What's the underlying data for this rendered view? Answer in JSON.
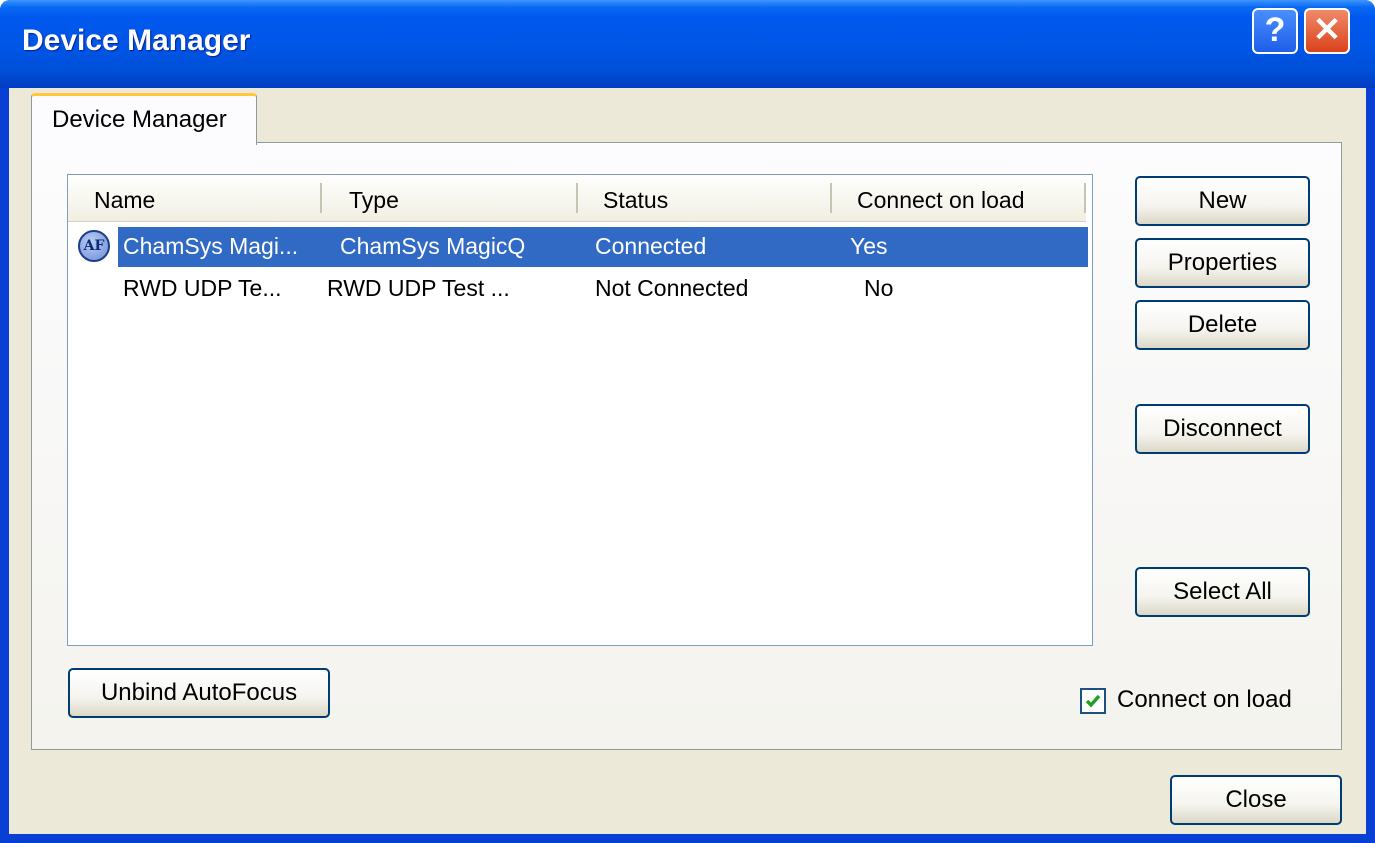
{
  "window": {
    "title": "Device Manager"
  },
  "tab": {
    "label": "Device Manager"
  },
  "table": {
    "columns": [
      "Name",
      "Type",
      "Status",
      "Connect on load"
    ],
    "rows": [
      {
        "icon": "autofocus-icon",
        "icon_text": "AF",
        "name": "ChamSys Magi...",
        "type": "ChamSys MagicQ",
        "status": "Connected",
        "connect_on_load": "Yes",
        "selected": true
      },
      {
        "name": "RWD UDP Te...",
        "type": "RWD UDP Test ...",
        "status": "Not Connected",
        "connect_on_load": "No",
        "selected": false
      }
    ]
  },
  "buttons": {
    "new": "New",
    "properties": "Properties",
    "delete": "Delete",
    "disconnect": "Disconnect",
    "select_all": "Select All",
    "unbind": "Unbind AutoFocus",
    "close": "Close"
  },
  "checkbox": {
    "label": "Connect on load",
    "checked": true
  },
  "title_buttons": {
    "help": "?",
    "close": "✕"
  },
  "colors": {
    "titlebar": "#0055e5",
    "selection": "#316ac5",
    "check": "#21a121"
  }
}
